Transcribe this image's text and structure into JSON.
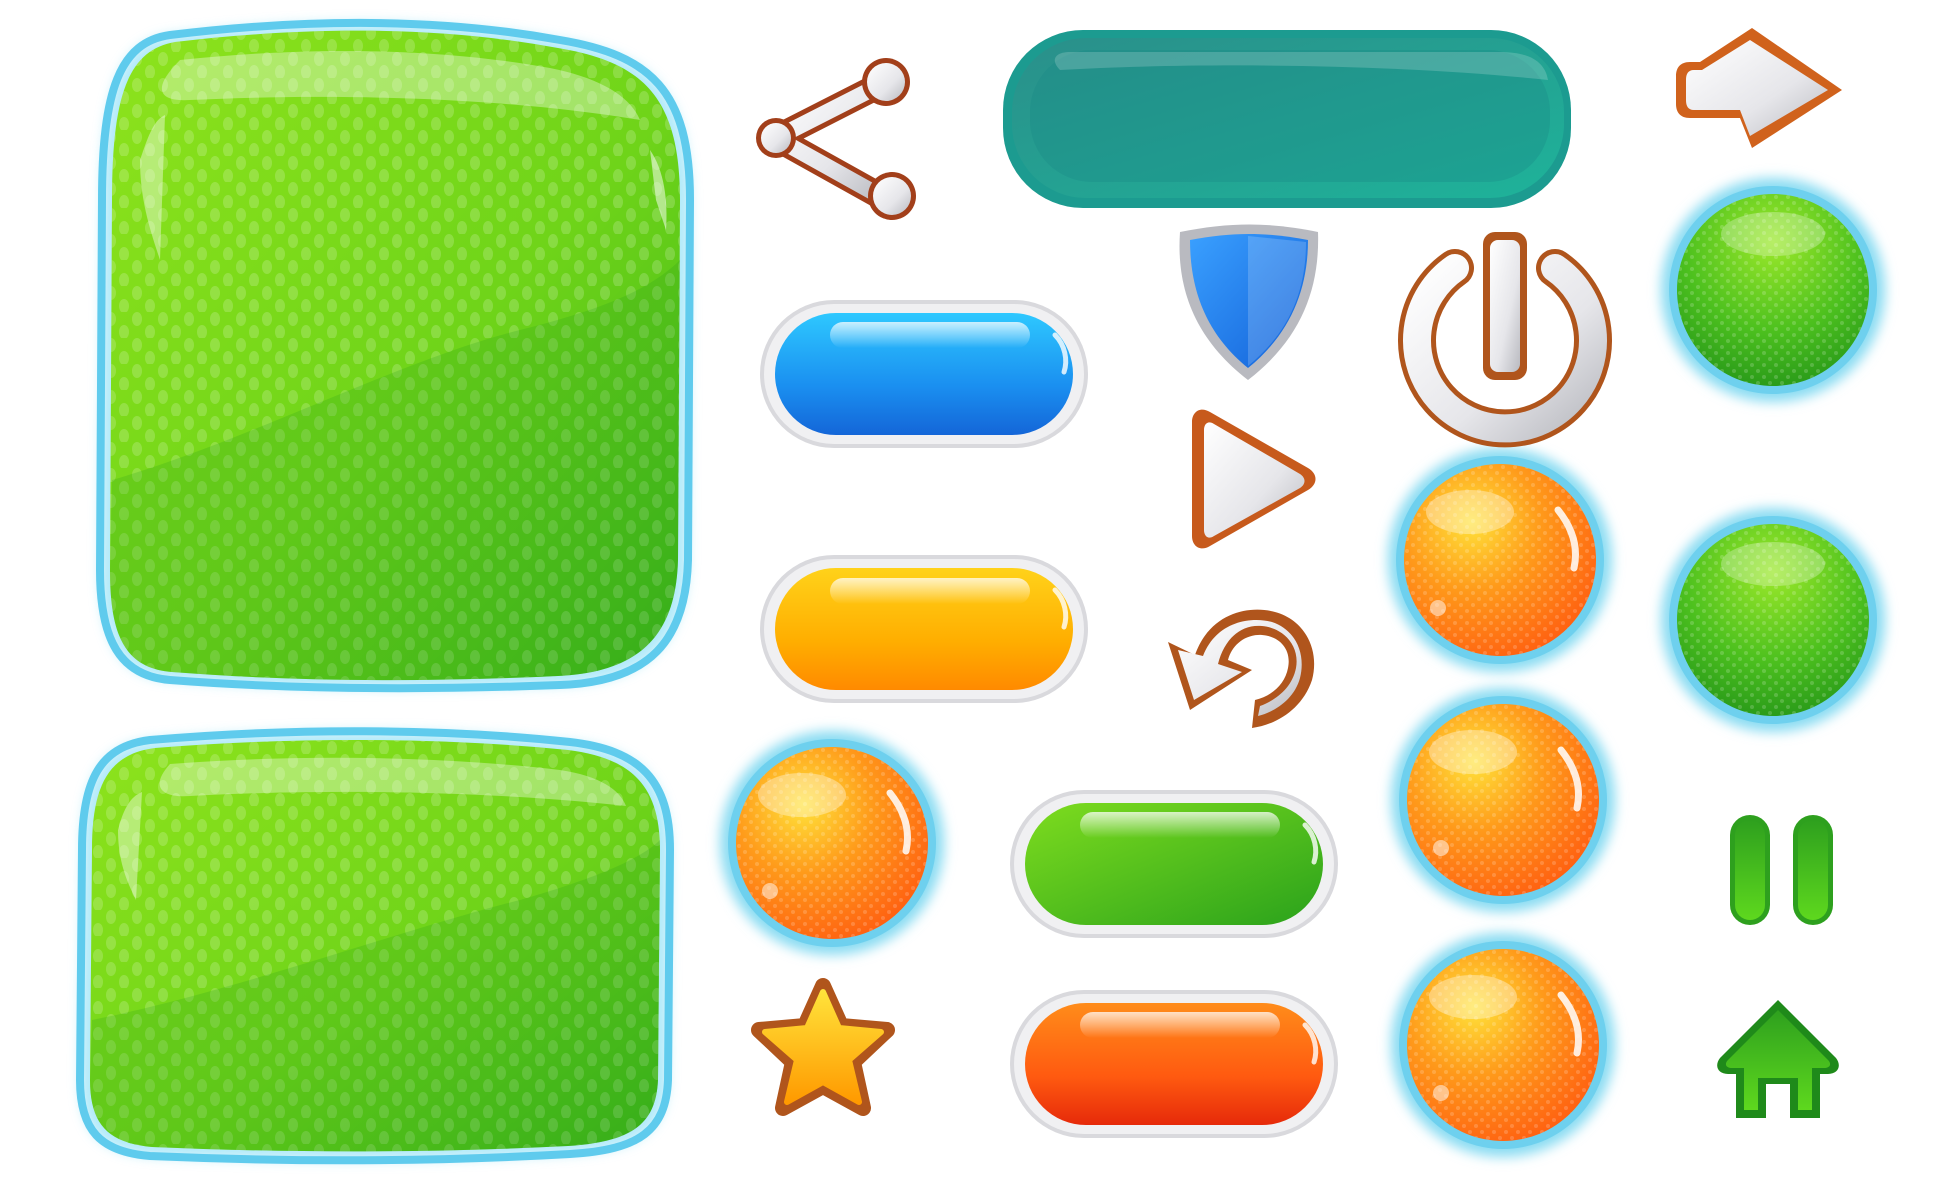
{
  "screen": {
    "kind": "game ui button kit",
    "visible_text": []
  },
  "colors": {
    "panel_green": "#7ad61a",
    "panel_glow": "#6fd3f0",
    "teal_bar": "#1e9a92",
    "pill_blue": "#1f8fe6",
    "pill_yellow": "#ffb000",
    "pill_green": "#4cbc1e",
    "pill_orange": "#ff6a10",
    "orb_orange": "#ff8a18",
    "orb_green": "#45b41c",
    "outline_brown": "#b8541c",
    "icon_silver": "#e8e8ea",
    "shield_blue": "#1e7ef0",
    "star_gold": "#ffc21a"
  },
  "panels": [
    {
      "name": "large-green-panel",
      "label": ""
    },
    {
      "name": "wide-green-panel",
      "label": ""
    },
    {
      "name": "teal-bar-panel",
      "label": ""
    }
  ],
  "pill_buttons": [
    {
      "name": "blue-pill-button",
      "color": "pill_blue",
      "label": ""
    },
    {
      "name": "yellow-pill-button",
      "color": "pill_yellow",
      "label": ""
    },
    {
      "name": "green-pill-button",
      "color": "pill_green",
      "label": ""
    },
    {
      "name": "orange-pill-button",
      "color": "pill_orange",
      "label": ""
    }
  ],
  "round_buttons": [
    {
      "name": "orange-orb-button-1",
      "color": "orb_orange"
    },
    {
      "name": "orange-orb-button-2",
      "color": "orb_orange"
    },
    {
      "name": "orange-orb-button-3",
      "color": "orb_orange"
    },
    {
      "name": "orange-orb-button-4",
      "color": "orb_orange"
    },
    {
      "name": "green-orb-button-1",
      "color": "orb_green"
    },
    {
      "name": "green-orb-button-2",
      "color": "orb_green"
    }
  ],
  "icons": [
    "share-icon",
    "arrow-right-icon",
    "shield-icon",
    "power-icon",
    "play-icon",
    "replay-icon",
    "star-icon",
    "pause-icon",
    "home-icon"
  ]
}
